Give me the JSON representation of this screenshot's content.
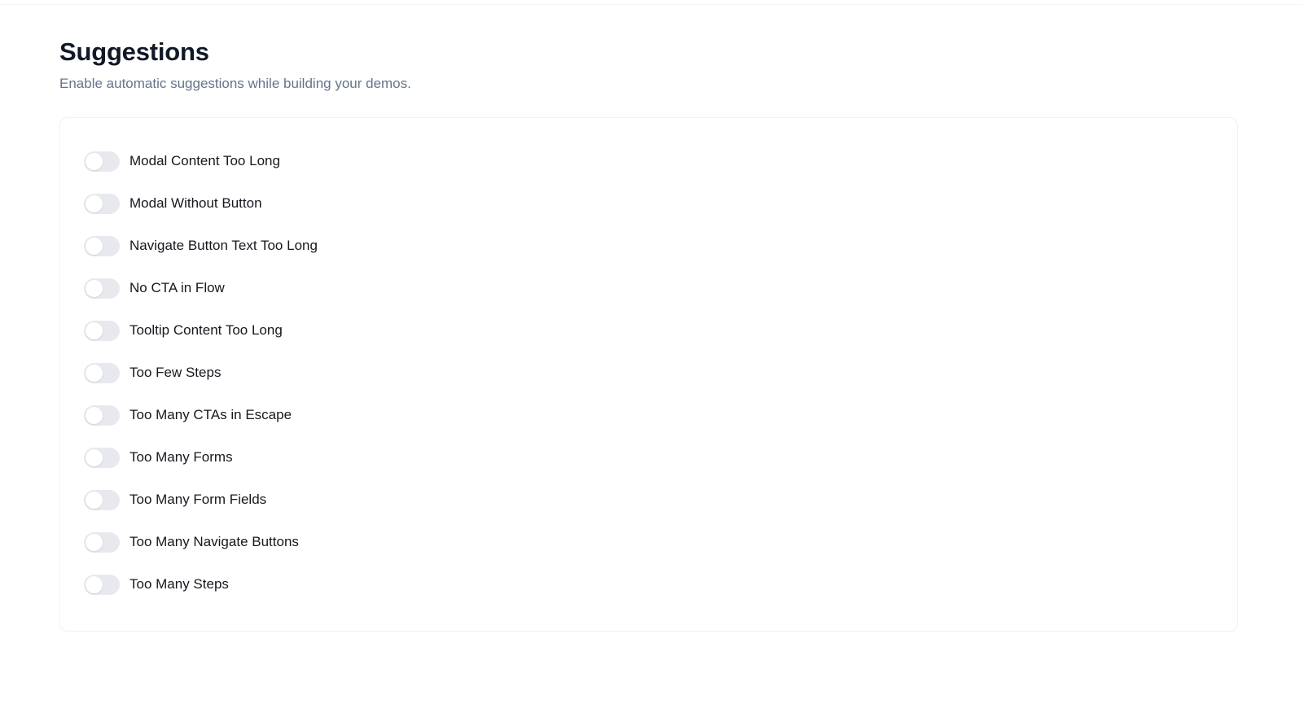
{
  "header": {
    "title": "Suggestions",
    "subtitle": "Enable automatic suggestions while building your demos."
  },
  "colors": {
    "title_text": "#111827",
    "subtitle_text": "#64748b",
    "label_text": "#15181e",
    "toggle_off_track": "#e7e9ee",
    "toggle_knob": "#ffffff",
    "card_border": "#f1f2f4",
    "page_background": "#ffffff"
  },
  "suggestions": {
    "items": [
      {
        "label": "Modal Content Too Long",
        "enabled": false,
        "state": "off"
      },
      {
        "label": "Modal Without Button",
        "enabled": false,
        "state": "off"
      },
      {
        "label": "Navigate Button Text Too Long",
        "enabled": false,
        "state": "off"
      },
      {
        "label": "No CTA in Flow",
        "enabled": false,
        "state": "off"
      },
      {
        "label": "Tooltip Content Too Long",
        "enabled": false,
        "state": "off"
      },
      {
        "label": "Too Few Steps",
        "enabled": false,
        "state": "off"
      },
      {
        "label": "Too Many CTAs in Escape",
        "enabled": false,
        "state": "off"
      },
      {
        "label": "Too Many Forms",
        "enabled": false,
        "state": "off"
      },
      {
        "label": "Too Many Form Fields",
        "enabled": false,
        "state": "off"
      },
      {
        "label": "Too Many Navigate Buttons",
        "enabled": false,
        "state": "off"
      },
      {
        "label": "Too Many Steps",
        "enabled": false,
        "state": "off"
      }
    ]
  }
}
